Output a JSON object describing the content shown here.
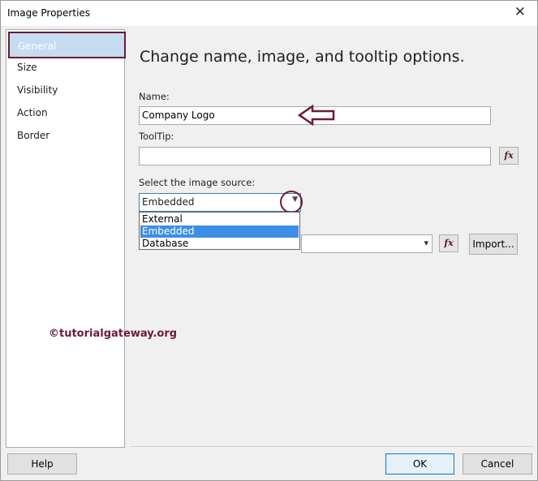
{
  "window": {
    "title": "Image Properties",
    "close_glyph": "✕"
  },
  "nav": {
    "items": [
      {
        "label": "General",
        "selected": true
      },
      {
        "label": "Size"
      },
      {
        "label": "Visibility"
      },
      {
        "label": "Action"
      },
      {
        "label": "Border"
      }
    ]
  },
  "main": {
    "heading": "Change name, image, and tooltip options.",
    "name_label": "Name:",
    "name_value": "Company Logo",
    "tooltip_label": "ToolTip:",
    "tooltip_value": "",
    "fx_label": "fx",
    "source_label": "Select the image source:",
    "source_value": "Embedded",
    "source_options": [
      "External",
      "Embedded",
      "Database"
    ],
    "import_label": "Import..."
  },
  "footer": {
    "help": "Help",
    "ok": "OK",
    "cancel": "Cancel"
  },
  "watermark": "©tutorialgateway.org",
  "colors": {
    "annotation": "#6e1a31",
    "highlight": "#3d8ee6",
    "nav_selected_bg": "#c6dcf1"
  }
}
